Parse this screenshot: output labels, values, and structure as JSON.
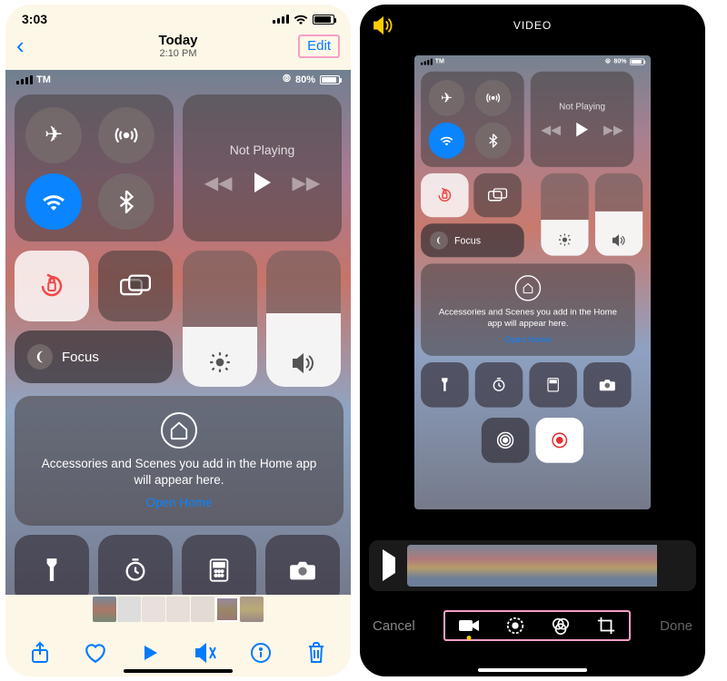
{
  "left": {
    "status": {
      "time": "3:03"
    },
    "nav": {
      "back": "‹",
      "title": "Today",
      "subtitle": "2:10 PM",
      "edit": "Edit"
    },
    "cc": {
      "carrier": "TM",
      "battery": "80%",
      "not_playing": "Not Playing",
      "focus": "Focus",
      "home_text": "Accessories and Scenes you add in the Home app will appear here.",
      "open_home": "Open Home"
    }
  },
  "right": {
    "header": "VIDEO",
    "cancel": "Cancel",
    "done": "Done",
    "cc": {
      "carrier": "TM",
      "battery": "80%",
      "not_playing": "Not Playing",
      "focus": "Focus",
      "home_text": "Accessories and Scenes you add in the Home app will appear here.",
      "open_home": "Open Home"
    }
  }
}
